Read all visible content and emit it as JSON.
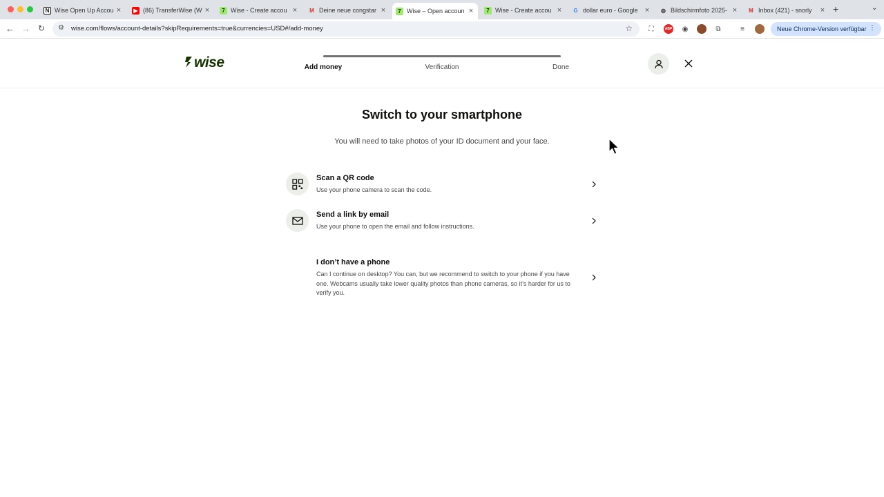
{
  "browser": {
    "tabs": [
      {
        "label": "Wise Open Up Accou",
        "icon": "notion-icon"
      },
      {
        "label": "(86) TransferWise (W",
        "icon": "youtube-icon"
      },
      {
        "label": "Wise - Create accou",
        "icon": "wise-icon"
      },
      {
        "label": "Deine neue congstar",
        "icon": "gmail-icon"
      },
      {
        "label": "Wise – Open accoun",
        "icon": "wise-icon",
        "active": true
      },
      {
        "label": "Wise - Create accou",
        "icon": "wise-icon"
      },
      {
        "label": "dollar euro - Google",
        "icon": "google-icon"
      },
      {
        "label": "Bildschirmfoto 2025-",
        "icon": "globe-icon"
      },
      {
        "label": "Inbox (421) - snorly",
        "icon": "gmail-icon"
      }
    ],
    "url": "wise.com/flows/account-details?skipRequirements=true&currencies=USD#/add-money",
    "update_label": "Neue Chrome-Version verfügbar"
  },
  "header": {
    "logo": "wise",
    "steps": [
      "Add money",
      "Verification",
      "Done"
    ],
    "current_step": "Add money"
  },
  "main": {
    "title": "Switch to your smartphone",
    "subtitle": "You will need to take photos of your ID document and your face.",
    "options": [
      {
        "title": "Scan a QR code",
        "description": "Use your phone camera to scan the code.",
        "icon": "qr-code-icon"
      },
      {
        "title": "Send a link by email",
        "description": "Use your phone to open the email and follow instructions.",
        "icon": "mail-icon"
      },
      {
        "title": "I don’t have a phone",
        "description": "Can I continue on desktop? You can, but we recommend to switch to your phone if you have one. Webcams usually take lower quality photos than phone cameras, so it’s harder for us to verify you."
      }
    ]
  },
  "colors": {
    "brand_green": "#163300",
    "brand_lime": "#9fe870",
    "icon_bg": "#eceeea",
    "text_secondary": "#454745"
  }
}
